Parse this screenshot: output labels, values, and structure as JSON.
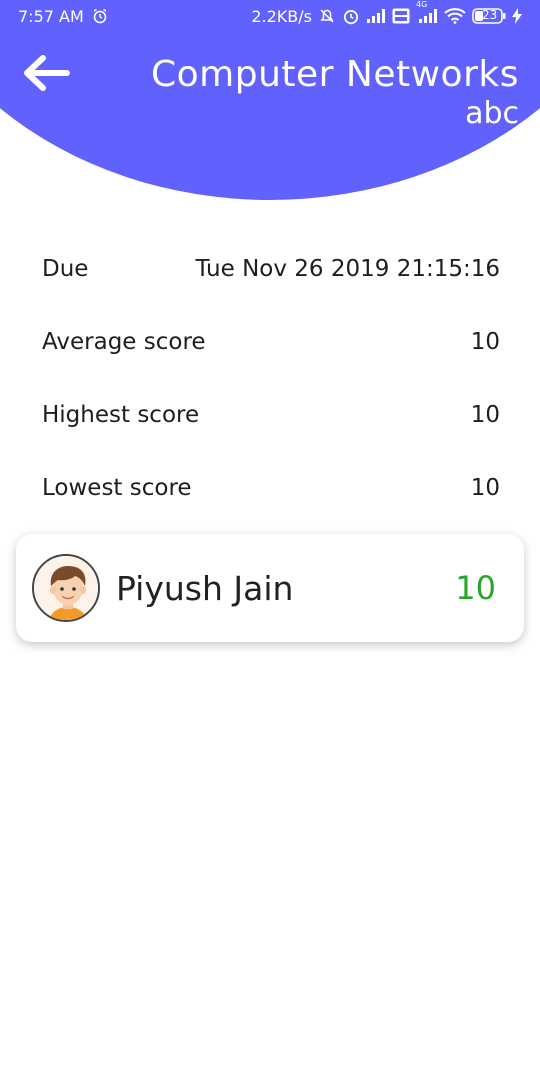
{
  "status_bar": {
    "time": "7:57 AM",
    "speed": "2.2KB/s",
    "network_label": "4G",
    "battery": "23"
  },
  "header": {
    "title": "Computer Networks",
    "subtitle": "abc"
  },
  "info": [
    {
      "label": "Due",
      "value": "Tue Nov 26 2019 21:15:16"
    },
    {
      "label": "Average score",
      "value": "10"
    },
    {
      "label": "Highest score",
      "value": "10"
    },
    {
      "label": "Lowest score",
      "value": "10"
    }
  ],
  "students": [
    {
      "name": "Piyush Jain",
      "score": "10"
    }
  ],
  "colors": {
    "header": "#6161fd",
    "score_green": "#27a52c"
  }
}
